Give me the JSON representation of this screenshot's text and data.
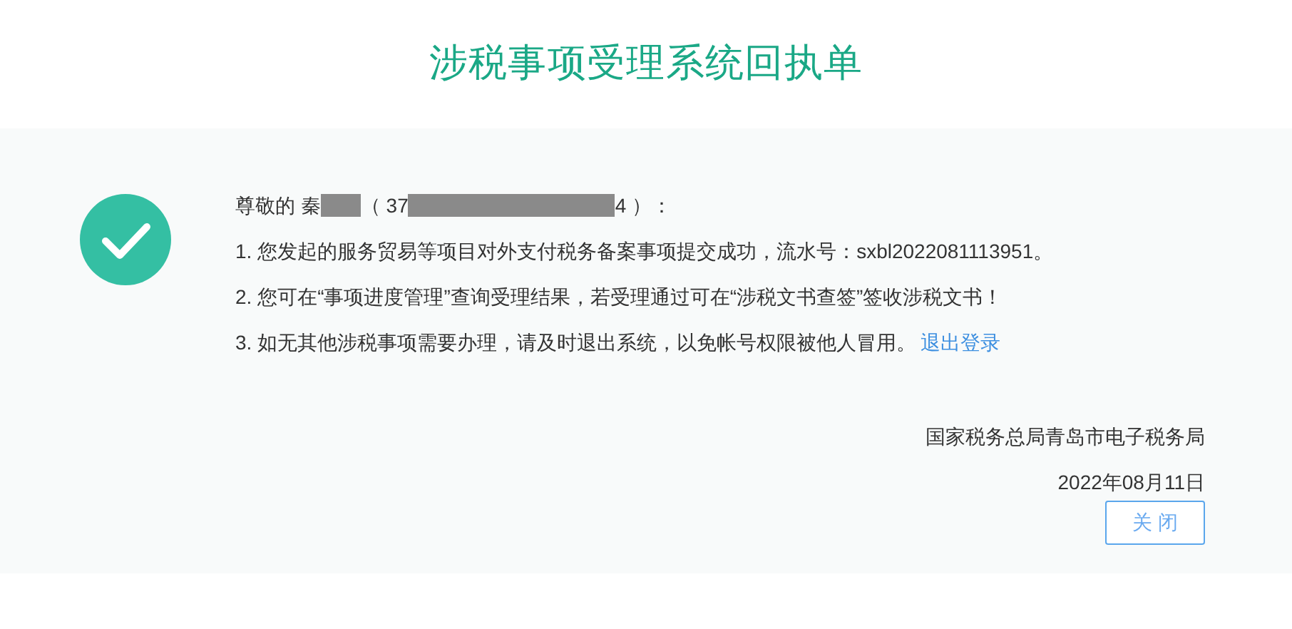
{
  "title": "涉税事项受理系统回执单",
  "greeting": {
    "salutation": "尊敬的 秦",
    "id_prefix": "（ 37",
    "id_suffix": "4 ）："
  },
  "lines": [
    "1. 您发起的服务贸易等项目对外支付税务备案事项提交成功，流水号：sxbl2022081113951。",
    "2. 您可在“事项进度管理”查询受理结果，若受理通过可在“涉税文书查签”签收涉税文书！",
    "3. 如无其他涉税事项需要办理，请及时退出系统，以免帐号权限被他人冒用。"
  ],
  "logout_link": "退出登录",
  "issuer": "国家税务总局青岛市电子税务局",
  "date": "2022年08月11日",
  "close_button": "关 闭"
}
